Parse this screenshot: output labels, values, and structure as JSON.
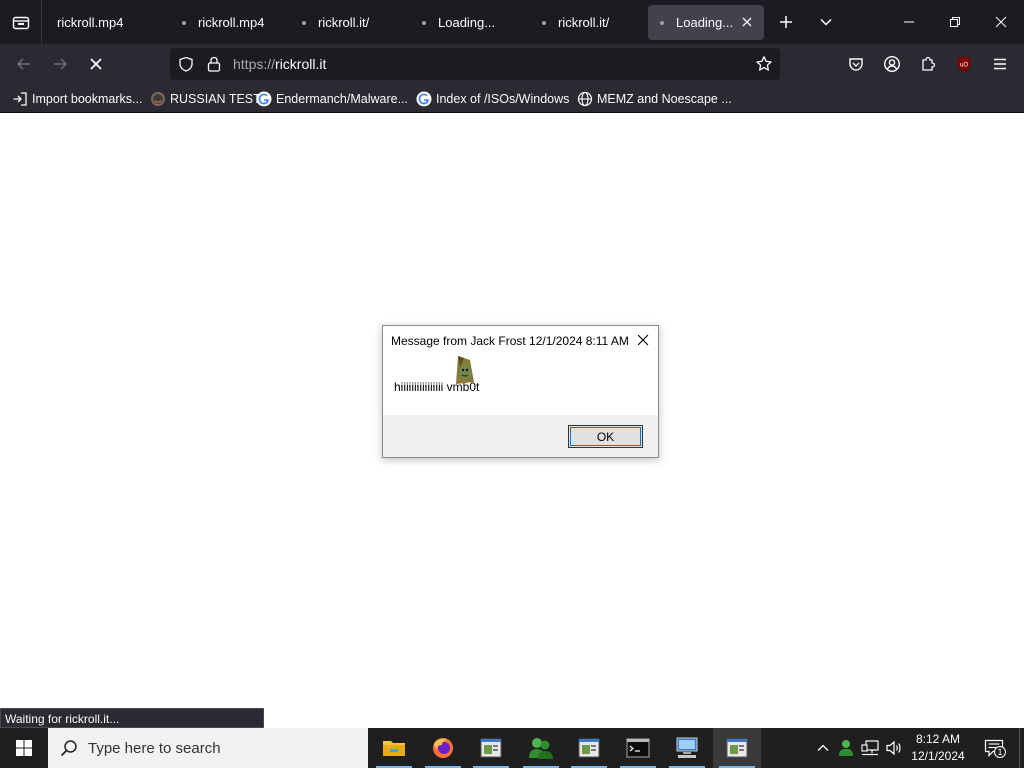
{
  "browser": {
    "tabs": [
      {
        "label": "rickroll.mp4",
        "active": false,
        "loading": false
      },
      {
        "label": "rickroll.mp4",
        "active": false,
        "loading": true
      },
      {
        "label": "rickroll.it/",
        "active": false,
        "loading": true
      },
      {
        "label": "Loading...",
        "active": false,
        "loading": true
      },
      {
        "label": "rickroll.it/",
        "active": false,
        "loading": true
      },
      {
        "label": "Loading...",
        "active": true,
        "loading": true
      }
    ],
    "url_prefix": "https://",
    "url_host": "rickroll.it",
    "bookmarks": [
      {
        "label": "Import bookmarks...",
        "icon": "import-icon"
      },
      {
        "label": "RUSSIAN TEST",
        "icon": "site-icon"
      },
      {
        "label": "Endermanch/Malware...",
        "icon": "google-icon"
      },
      {
        "label": "Index of /ISOs/Windows",
        "icon": "google-icon"
      },
      {
        "label": "MEMZ and Noescape ...",
        "icon": "globe-icon"
      }
    ],
    "status_text": "Waiting for rickroll.it..."
  },
  "dialog": {
    "title": "Message from Jack Frost 12/1/2024 8:11 AM",
    "message": "hiiiiiiiiiiiiiiii vmb0t",
    "ok_label": "OK"
  },
  "taskbar": {
    "search_placeholder": "Type here to search",
    "time": "8:12 AM",
    "date": "12/1/2024",
    "notification_count": "1",
    "apps": [
      "file-explorer",
      "firefox",
      "app-window",
      "messenger",
      "app-window",
      "terminal",
      "network-computer",
      "app-window"
    ]
  },
  "colors": {
    "tabbar_bg": "#1c1b22",
    "toolbar_bg": "#2b2a33",
    "active_tab": "#42414d",
    "ublock_red": "#800000",
    "taskbar_accent": "#76b9ed"
  }
}
